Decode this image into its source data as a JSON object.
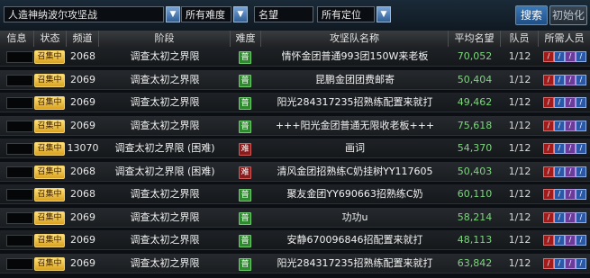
{
  "filters": {
    "dungeon": "人造神纳波尔攻坚战",
    "difficulty": "所有难度",
    "reputation_placeholder": "名望",
    "position": "所有定位",
    "search_button": "搜索",
    "reset_button": "初始化"
  },
  "columns": [
    "信息",
    "状态",
    "频道",
    "阶段",
    "难度",
    "攻坚队名称",
    "平均名望",
    "队员",
    "所需人员"
  ],
  "difficulty_labels": {
    "normal": "普",
    "hard": "难"
  },
  "rows": [
    {
      "status": "召集中",
      "channel": "2068",
      "stage": "调查太初之界限",
      "difficulty": "普",
      "team": "情怀金团普通993团150W来老板",
      "score": "70,052",
      "members": "1/12"
    },
    {
      "status": "召集中",
      "channel": "2069",
      "stage": "调查太初之界限",
      "difficulty": "普",
      "team": "昆鹏金团团费邮寄",
      "score": "50,404",
      "members": "1/12"
    },
    {
      "status": "召集中",
      "channel": "2069",
      "stage": "调查太初之界限",
      "difficulty": "普",
      "team": "阳光284317235招熟练配置来就打",
      "score": "49,462",
      "members": "1/12"
    },
    {
      "status": "召集中",
      "channel": "2069",
      "stage": "调查太初之界限",
      "difficulty": "普",
      "team": "+++阳光金团普通无限收老板+++",
      "score": "75,618",
      "members": "1/12"
    },
    {
      "status": "召集中",
      "channel": "13070",
      "stage": "调查太初之界限 (困难)",
      "difficulty": "难",
      "team": "画词",
      "score": "54,370",
      "members": "1/12"
    },
    {
      "status": "召集中",
      "channel": "2068",
      "stage": "调查太初之界限 (困难)",
      "difficulty": "难",
      "team": "清风金团招熟练C奶挂树YY117605",
      "score": "50,403",
      "members": "1/12"
    },
    {
      "status": "召集中",
      "channel": "2068",
      "stage": "调查太初之界限",
      "difficulty": "普",
      "team": "聚友金团YY690663招熟练C奶",
      "score": "60,110",
      "members": "1/12"
    },
    {
      "status": "召集中",
      "channel": "2069",
      "stage": "调查太初之界限",
      "difficulty": "普",
      "team": "功功u",
      "score": "58,214",
      "members": "1/12"
    },
    {
      "status": "召集中",
      "channel": "2069",
      "stage": "调查太初之界限",
      "difficulty": "普",
      "team": "安静670096846招配置来就打",
      "score": "48,113",
      "members": "1/12"
    },
    {
      "status": "召集中",
      "channel": "2069",
      "stage": "调查太初之界限",
      "difficulty": "普",
      "team": "阳光284317235招熟练配置来就打",
      "score": "63,842",
      "members": "1/12"
    }
  ]
}
